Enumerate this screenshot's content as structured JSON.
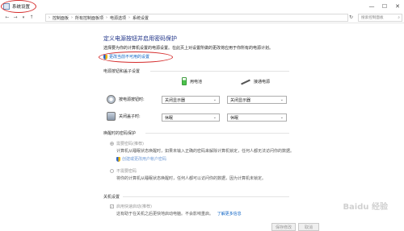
{
  "window": {
    "title": "系统设置",
    "controls": [
      "—",
      "☐",
      "✕"
    ]
  },
  "addressbar": {
    "back": "←",
    "forward": "→",
    "up": "↑",
    "crumbs": [
      "控制面板",
      "所有控制面板项",
      "电源选项",
      "系统设置"
    ],
    "separator": "›",
    "refresh": "↻",
    "search_placeholder": "搜索控制面板",
    "search_icon": "⌕"
  },
  "main": {
    "heading": "定义电源按钮并启用密码保护",
    "description": "选择要为你的计算机设置的电源设置。在此页上对设置所做的更改将应用于你所有的电源计划。",
    "change_link": "更改当前不可用的设置",
    "buttons_section": {
      "title": "电源按钮和盖子设置",
      "col_battery": "用电池",
      "col_plugged": "接通电源",
      "rows": [
        {
          "label": "按电源按钮时:",
          "battery": "关闭显示器",
          "plugged": "关闭显示器"
        },
        {
          "label": "关闭盖子时:",
          "battery": "休眠",
          "plugged": "休眠"
        }
      ]
    },
    "wake_section": {
      "title": "唤醒时的密码保护",
      "require_label": "需要密码(推荐)",
      "require_desc_1": "计算机从睡眠状态唤醒时，如果未输入正确的密码来解除计算机锁定，任何人都无法访问你的数据。",
      "create_link": "创建或更改用户帐户密码",
      "norequire_label": "不需要密码",
      "norequire_desc": "将你的计算机从睡眠状态唤醒时，任何人都可以访问你的数据，因为计算机未锁定。"
    },
    "shutdown_section": {
      "title": "关机设置",
      "fast_startup_label": "启用快速启动(推荐)",
      "fast_startup_desc": "这有助于在关机之后更快地启动电脑。不会影响重启。",
      "learn_more": "了解更多信息"
    },
    "footer": {
      "save": "保存修改",
      "cancel": "取消"
    }
  },
  "watermark": "Baidu 经验",
  "colors": {
    "heading": "#1e3287",
    "link": "#0b62c4",
    "annotation": "#d52b2b"
  }
}
